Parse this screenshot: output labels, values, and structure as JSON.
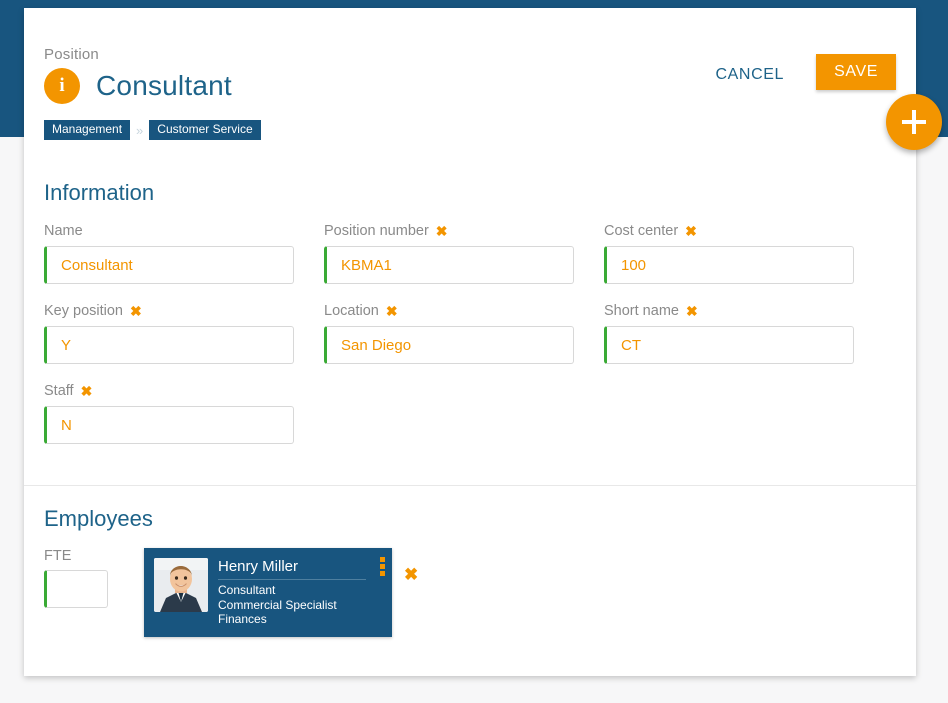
{
  "header": {
    "eyebrow": "Position",
    "title": "Consultant",
    "info_icon": "info-icon",
    "breadcrumb": {
      "items": [
        "Management",
        "Customer Service"
      ],
      "separator": "»"
    },
    "cancel_label": "CANCEL",
    "save_label": "SAVE"
  },
  "fab": {
    "label": "+",
    "name": "add-button"
  },
  "information": {
    "heading": "Information",
    "fields": [
      {
        "label": "Name",
        "required": false,
        "value": "Consultant",
        "placeholder": ""
      },
      {
        "label": "Position number",
        "required": true,
        "value": "KBMA1",
        "placeholder": ""
      },
      {
        "label": "Cost center",
        "required": true,
        "value": "100",
        "placeholder": ""
      },
      {
        "label": "Key position",
        "required": true,
        "value": "Y",
        "placeholder": ""
      },
      {
        "label": "Location",
        "required": true,
        "value": "San Diego",
        "placeholder": ""
      },
      {
        "label": "Short name",
        "required": true,
        "value": "CT",
        "placeholder": ""
      },
      {
        "label": "Staff",
        "required": true,
        "value": "N",
        "placeholder": ""
      }
    ],
    "required_marker": "✖"
  },
  "employees": {
    "heading": "Employees",
    "fte_label": "FTE",
    "fte_value": "",
    "fte_placeholder": "",
    "card": {
      "name": "Henry Miller",
      "role": "Consultant",
      "department": "Commercial Specialist",
      "unit": "Finances",
      "menu_icon": "vertical-dots-icon"
    },
    "remove_marker": "✖"
  },
  "colors": {
    "brand_blue": "#18557f",
    "title_blue": "#1e6389",
    "accent_orange": "#f39500",
    "valid_green": "#3aaa35",
    "label_gray": "#8a8a8a"
  }
}
